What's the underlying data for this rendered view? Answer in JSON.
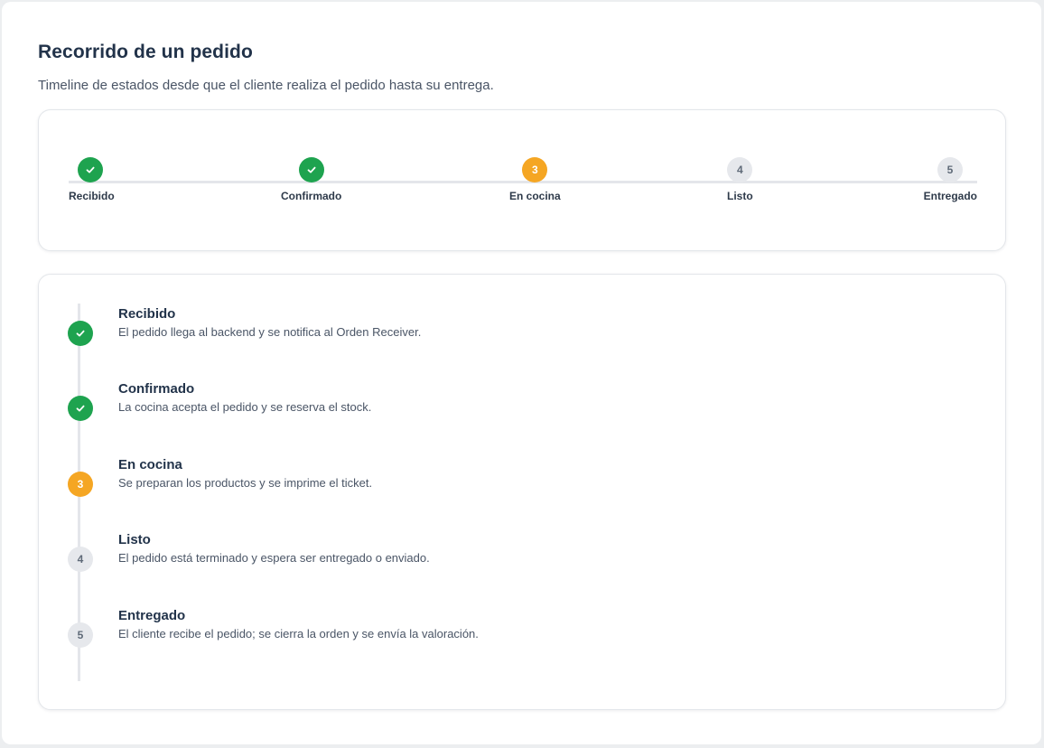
{
  "header": {
    "title": "Recorrido de un pedido",
    "subtitle": "Timeline de estados desde que el cliente realiza el pedido hasta su entrega."
  },
  "stepper": {
    "steps": [
      {
        "label": "Recibido",
        "number": "1",
        "state": "done"
      },
      {
        "label": "Confirmado",
        "number": "2",
        "state": "done"
      },
      {
        "label": "En cocina",
        "number": "3",
        "state": "current"
      },
      {
        "label": "Listo",
        "number": "4",
        "state": "pending"
      },
      {
        "label": "Entregado",
        "number": "5",
        "state": "pending"
      }
    ]
  },
  "timeline": {
    "items": [
      {
        "title": "Recibido",
        "description": "El pedido llega al backend y se notifica al Orden Receiver.",
        "number": "1",
        "state": "done"
      },
      {
        "title": "Confirmado",
        "description": "La cocina acepta el pedido y se reserva el stock.",
        "number": "2",
        "state": "done"
      },
      {
        "title": "En cocina",
        "description": "Se preparan los productos y se imprime el ticket.",
        "number": "3",
        "state": "current"
      },
      {
        "title": "Listo",
        "description": "El pedido está terminado y espera ser entregado o enviado.",
        "number": "4",
        "state": "pending"
      },
      {
        "title": "Entregado",
        "description": "El cliente recibe el pedido; se cierra la orden y se envía la valoración.",
        "number": "5",
        "state": "pending"
      }
    ]
  },
  "colors": {
    "done": "#1ea34f",
    "current": "#f5a623",
    "pending": "#e6e8ec",
    "icon_done": "check-icon"
  }
}
